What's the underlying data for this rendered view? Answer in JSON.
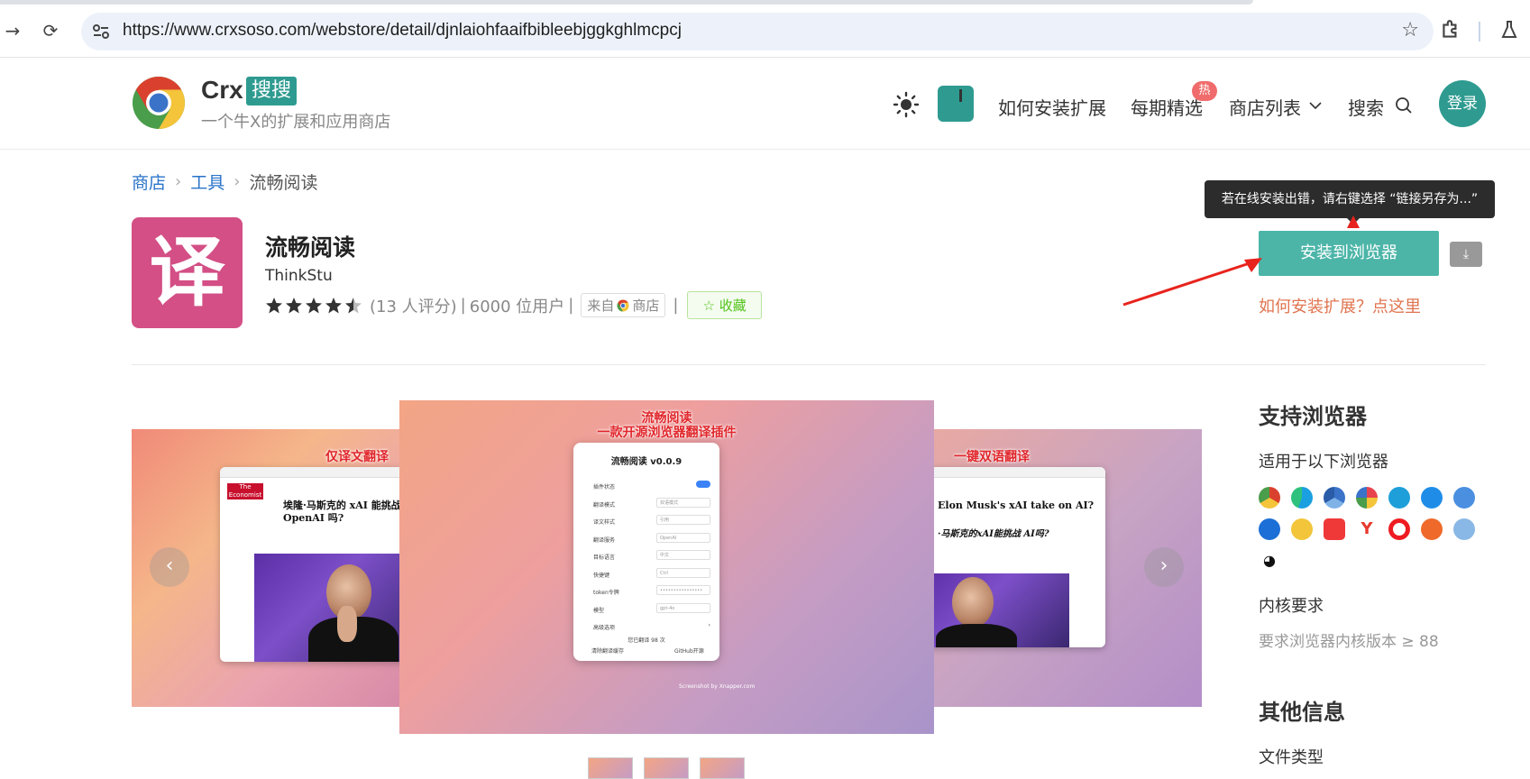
{
  "browser": {
    "url": "https://www.crxsoso.com/webstore/detail/djnlaiohfaaifbibleebjggkghlmcpcj"
  },
  "header": {
    "brand": "Crx",
    "brand_badge": "搜搜",
    "slogan": "一个牛X的扩展和应用商店",
    "nav": {
      "how_to_install": "如何安装扩展",
      "weekly_picks": "每期精选",
      "hot_badge": "热",
      "store_list": "商店列表",
      "search": "搜索"
    },
    "login": "登录"
  },
  "breadcrumb": {
    "store": "商店",
    "category": "工具",
    "current": "流畅阅读"
  },
  "app": {
    "icon_char": "译",
    "icon_color": "#d34f85",
    "name": "流畅阅读",
    "author": "ThinkStu",
    "rating": 4.5,
    "rating_text": "(13 人评分)",
    "users_text": "6000 位用户",
    "source_prefix": "来自",
    "source_suffix": "商店",
    "favorite": "收藏"
  },
  "install": {
    "tooltip": "若在线安装出错，请右键选择 “链接另存为...”",
    "button": "安装到浏览器",
    "howto": "如何安装扩展？点这里"
  },
  "carousel": {
    "left_caption": "仅译文翻译",
    "center_caption_1": "流畅阅读",
    "center_caption_2": "一款开源浏览器翻译插件",
    "right_caption": "一键双语翻译",
    "left_headline": "埃隆·马斯克的 xAI 能挑战 OpenAI 吗?",
    "right_headline_en": "Elon Musk's xAI take on AI?",
    "right_headline_zh": "·马斯克的xAI能挑战 AI吗?",
    "panel": {
      "title": "流畅阅读 v0.0.9",
      "rows": [
        {
          "label": "插件状态",
          "value": ""
        },
        {
          "label": "翻译模式",
          "value": "双语模式"
        },
        {
          "label": "译文样式",
          "value": "引用"
        },
        {
          "label": "翻译服务",
          "value": "OpenAI"
        },
        {
          "label": "目标语言",
          "value": "中文"
        },
        {
          "label": "快捷键",
          "value": "Ctrl"
        },
        {
          "label": "token令牌",
          "value": "••••••••••••••••"
        },
        {
          "label": "模型",
          "value": "gpt-4o"
        },
        {
          "label": "高级选项",
          "value": ""
        }
      ],
      "footer_count": "您已翻译 98 次",
      "footer_clear": "清除翻译缓存",
      "footer_github": "GitHub开源",
      "credit": "Screenshot by Xnapper.com"
    }
  },
  "sidebar": {
    "browsers_title": "支持浏览器",
    "browsers_sub": "适用于以下浏览器",
    "browsers": [
      "chrome",
      "edge",
      "chrome-dev",
      "360-speed",
      "ie",
      "qq-browser",
      "sogou",
      "maxthon",
      "star-browser",
      "vivaldi",
      "yandex",
      "opera",
      "firefox-like",
      "twin-browser",
      "panda-browser"
    ],
    "kernel_title": "内核要求",
    "kernel_text": "要求浏览器内核版本 ≥ 88",
    "other_title": "其他信息",
    "file_type": "文件类型"
  }
}
